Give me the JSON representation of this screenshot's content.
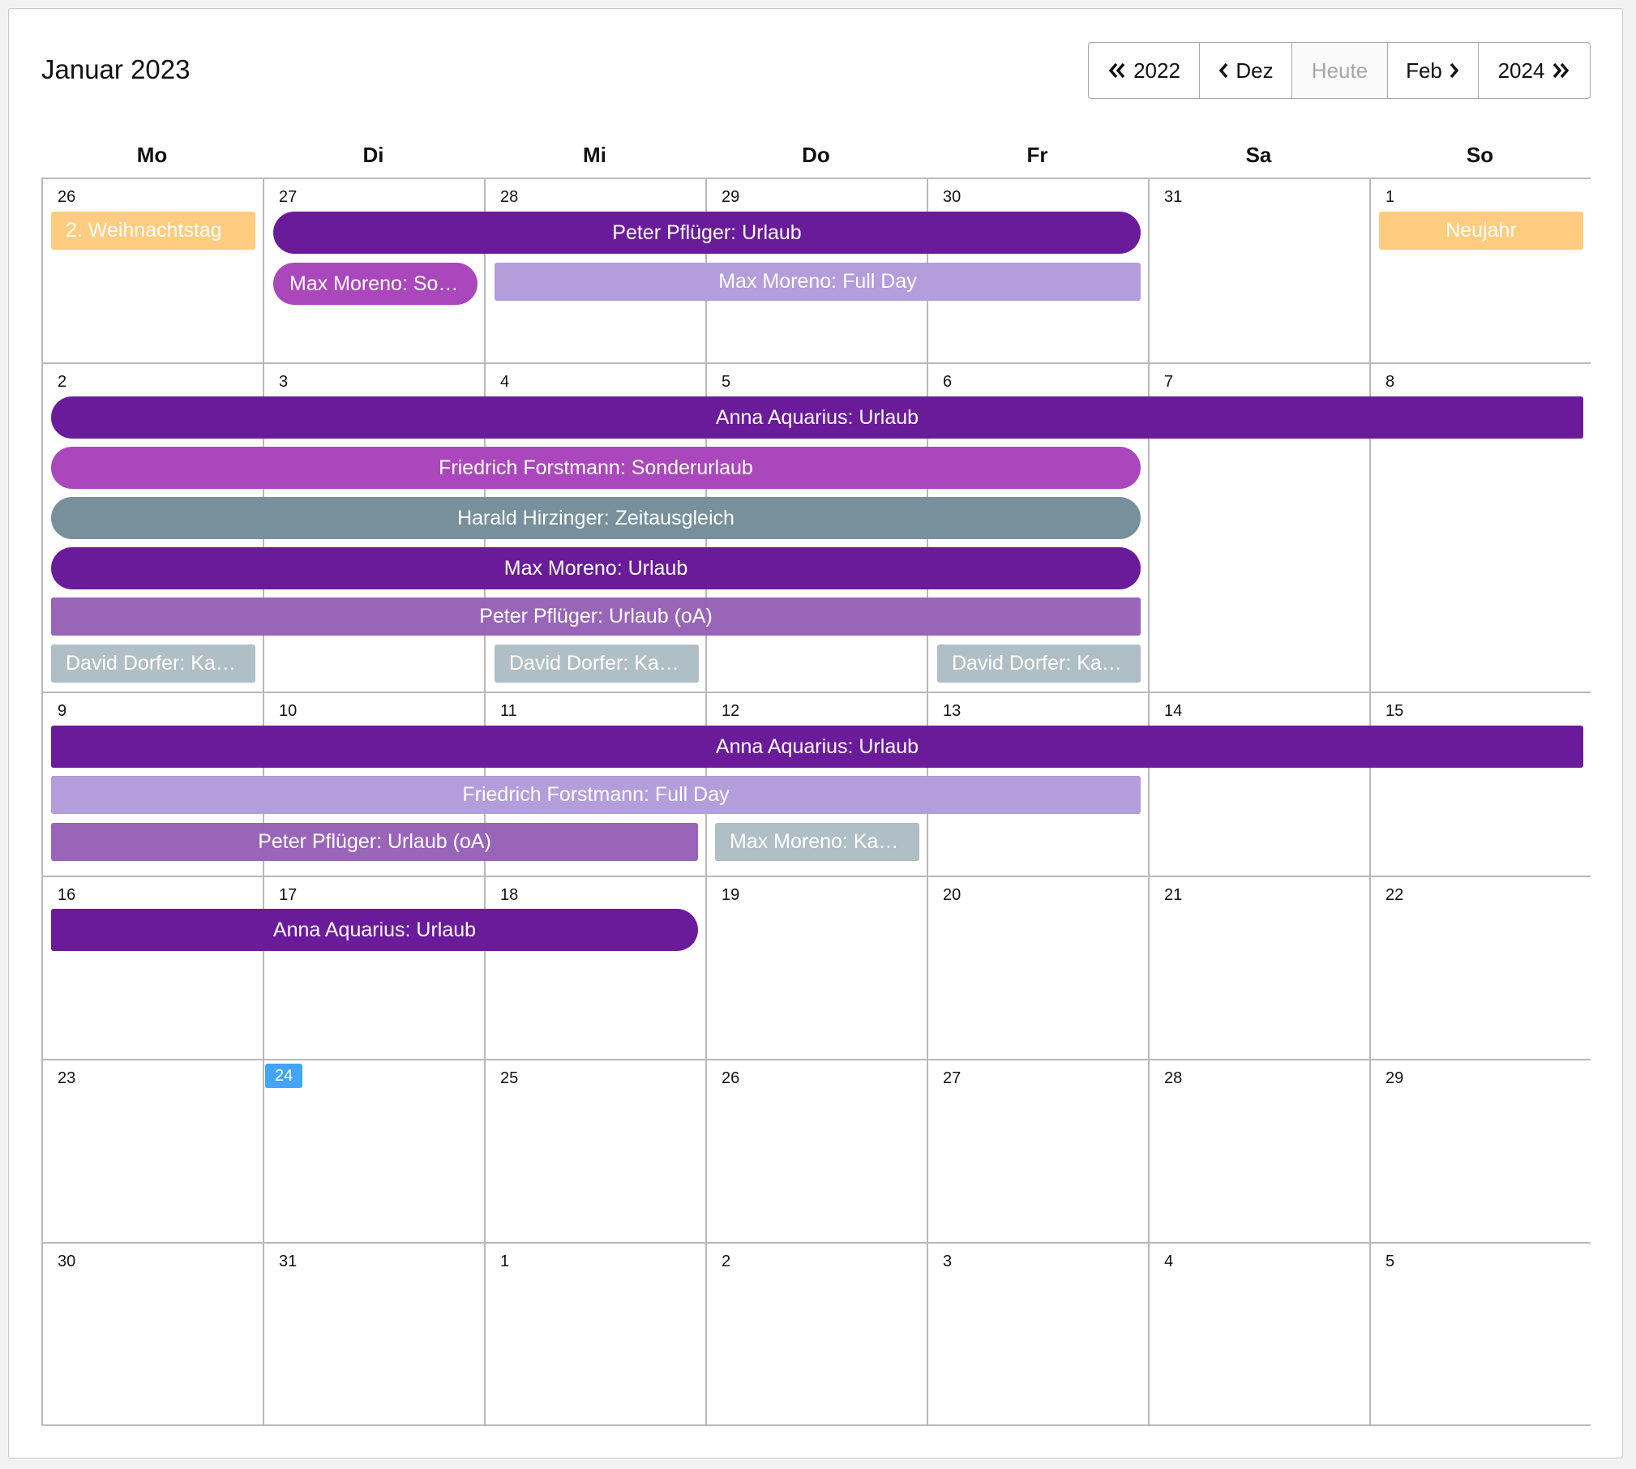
{
  "header": {
    "title": "Januar 2023"
  },
  "nav": {
    "prev_year": "2022",
    "prev_month": "Dez",
    "today": "Heute",
    "next_month": "Feb",
    "next_year": "2024"
  },
  "weekdays": [
    "Mo",
    "Di",
    "Mi",
    "Do",
    "Fr",
    "Sa",
    "So"
  ],
  "weeks": [
    {
      "dates": [
        "26",
        "27",
        "28",
        "29",
        "30",
        "31",
        "1"
      ]
    },
    {
      "dates": [
        "2",
        "3",
        "4",
        "5",
        "6",
        "7",
        "8"
      ]
    },
    {
      "dates": [
        "9",
        "10",
        "11",
        "12",
        "13",
        "14",
        "15"
      ]
    },
    {
      "dates": [
        "16",
        "17",
        "18",
        "19",
        "20",
        "21",
        "22"
      ]
    },
    {
      "dates": [
        "23",
        "24",
        "25",
        "26",
        "27",
        "28",
        "29"
      ]
    },
    {
      "dates": [
        "30",
        "31",
        "1",
        "2",
        "3",
        "4",
        "5"
      ]
    }
  ],
  "today_date": "24",
  "events": {
    "w1_holiday_mo": "2. Weihnachtstag",
    "w1_peter": "Peter Pflüger: Urlaub",
    "w1_neujahr": "Neujahr",
    "w1_max_so": "Max Moreno: Sonderurlaub",
    "w1_max_fullday": "Max Moreno: Full Day",
    "w2_anna": "Anna Aquarius: Urlaub",
    "w2_friedrich": "Friedrich Forstmann: Sonderurlaub",
    "w2_harald": "Harald Hirzinger: Zeitausgleich",
    "w2_max": "Max Moreno: Urlaub",
    "w2_peter_oa": "Peter Pflüger: Urlaub (oA)",
    "w2_david_mo": "David Dorfer: Karenz",
    "w2_david_mi": "David Dorfer: Karenz",
    "w2_david_fr": "David Dorfer: Karenz",
    "w3_anna": "Anna Aquarius: Urlaub",
    "w3_friedrich": "Friedrich Forstmann: Full Day",
    "w3_peter_oa": "Peter Pflüger: Urlaub (oA)",
    "w3_max_kar": "Max Moreno: Karenz",
    "w4_anna": "Anna Aquarius: Urlaub"
  },
  "colors": {
    "urlaub": "#6a1b9a",
    "sonderurlaub": "#ab47bc",
    "zeitausgleich": "#78909c",
    "full_day": "#b39ddb",
    "urlaub_oa": "#9762b8",
    "karenz": "#b0bec5",
    "holiday": "#ffcc80",
    "today": "#42a5f5"
  }
}
